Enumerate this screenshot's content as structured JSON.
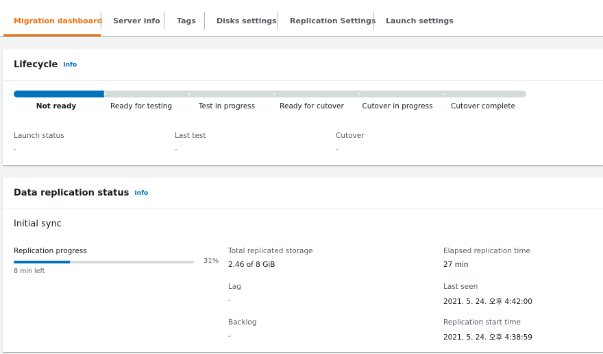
{
  "tabs": [
    {
      "label": "Migration dashboard",
      "active": true
    },
    {
      "label": "Server info",
      "active": false
    },
    {
      "label": "Tags",
      "active": false
    },
    {
      "label": "Disks settings",
      "active": false
    },
    {
      "label": "Replication Settings",
      "active": false
    },
    {
      "label": "Launch settings",
      "active": false
    }
  ],
  "lifecycle": {
    "title": "Lifecycle",
    "info_label": "Info",
    "stages": [
      {
        "label": "Not ready",
        "current": true
      },
      {
        "label": "Ready for testing",
        "current": false
      },
      {
        "label": "Test in progress",
        "current": false
      },
      {
        "label": "Ready for cutover",
        "current": false
      },
      {
        "label": "Cutover in progress",
        "current": false
      },
      {
        "label": "Cutover complete",
        "current": false
      }
    ],
    "fields": [
      {
        "key": "Launch status",
        "value": "-"
      },
      {
        "key": "Last test",
        "value": "-"
      },
      {
        "key": "Cutover",
        "value": "-"
      }
    ]
  },
  "replication": {
    "title": "Data replication status",
    "info_label": "Info",
    "subtitle": "Initial sync",
    "progress_label": "Replication progress",
    "progress_percent": 31,
    "progress_text": "31%",
    "time_left": "8 min left",
    "total_storage_label": "Total replicated storage",
    "total_storage_value": "2.46 of 8 GiB",
    "lag_label": "Lag",
    "lag_value": "-",
    "backlog_label": "Backlog",
    "backlog_value": "-",
    "elapsed_label": "Elapsed replication time",
    "elapsed_value": "27 min",
    "last_seen_label": "Last seen",
    "last_seen_value": "2021. 5. 24. 오후 4:42:00",
    "start_time_label": "Replication start time",
    "start_time_value": "2021. 5. 24. 오후 4:38:59"
  },
  "colors": {
    "accent": "#ec7211",
    "link": "#0073bb",
    "progress": "#0073bb",
    "track": "#d5dbdb"
  }
}
